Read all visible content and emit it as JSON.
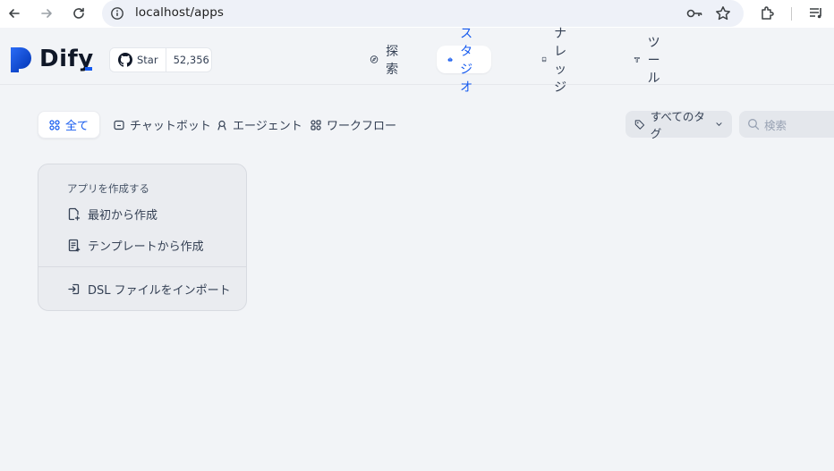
{
  "browser": {
    "url": "localhost/apps"
  },
  "header": {
    "logo_text": "Dify",
    "github": {
      "star_label": "Star",
      "count": "52,356"
    },
    "nav": [
      {
        "label": "探索",
        "icon": "compass-icon",
        "active": false
      },
      {
        "label": "スタジオ",
        "icon": "robot-icon",
        "active": true
      },
      {
        "label": "ナレッジ",
        "icon": "book-icon",
        "active": false
      },
      {
        "label": "ツール",
        "icon": "hammer-icon",
        "active": false
      }
    ]
  },
  "filters": {
    "tabs": [
      {
        "label": "全て",
        "icon": "grid-icon",
        "active": true
      },
      {
        "label": "チャットボット",
        "icon": "chat-icon",
        "active": false
      },
      {
        "label": "エージェント",
        "icon": "agent-icon",
        "active": false
      },
      {
        "label": "ワークフロー",
        "icon": "workflow-icon",
        "active": false
      }
    ],
    "tag_select": "すべてのタグ",
    "search_placeholder": "検索"
  },
  "create_card": {
    "title": "アプリを作成する",
    "actions": [
      {
        "label": "最初から作成",
        "icon": "new-file-icon"
      },
      {
        "label": "テンプレートから作成",
        "icon": "template-icon"
      },
      {
        "label": "DSL ファイルをインポート",
        "icon": "import-icon"
      }
    ]
  },
  "colors": {
    "accent": "#155aef",
    "background": "#f2f4f7"
  }
}
